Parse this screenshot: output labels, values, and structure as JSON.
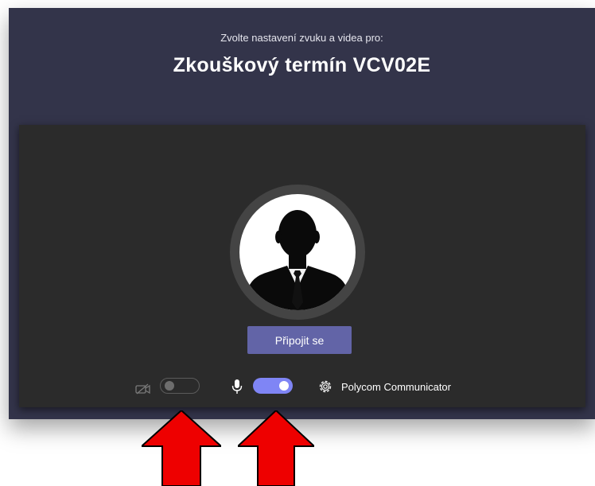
{
  "header": {
    "subtitle": "Zvolte nastavení zvuku a videa pro:",
    "title": "Zkouškový termín VCV02E"
  },
  "preview": {
    "join_label": "Připojit se",
    "camera_enabled": false,
    "microphone_enabled": true,
    "audio_device": "Polycom Communicator"
  },
  "icons": {
    "camera": "camera-off-icon",
    "microphone": "microphone-icon",
    "settings": "gear-icon"
  },
  "colors": {
    "window_bg": "#33344a",
    "preview_bg": "#2b2b2b",
    "accent": "#6264a7",
    "toggle_on": "#7f85f5",
    "annotation_arrow": "#ee0000"
  }
}
